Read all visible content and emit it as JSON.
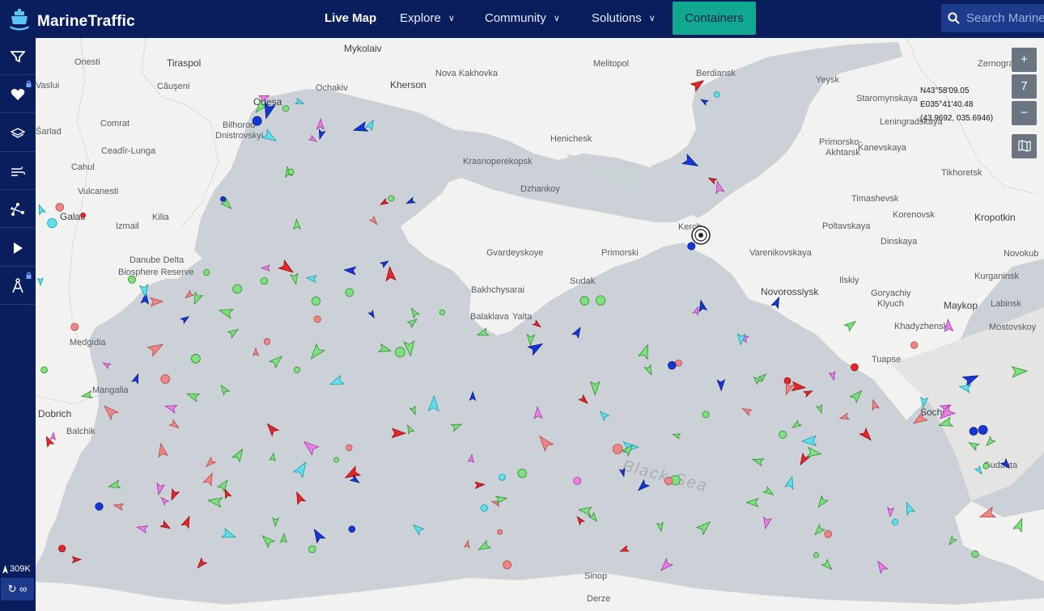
{
  "header": {
    "brand": "MarineTraffic",
    "nav": [
      "Live Map",
      "Explore",
      "Community",
      "Solutions"
    ],
    "containers_label": "Containers",
    "search_placeholder": "Search MarineTraffic"
  },
  "sidebar": {
    "items": [
      "filter-icon",
      "heart-icon",
      "layers-icon",
      "wind-icon",
      "route-icon",
      "play-icon",
      "measure-icon"
    ],
    "vessel_count": "309K",
    "infinity_label": "∞"
  },
  "map_controls": {
    "zoom_in": "+",
    "zoom_level": "7",
    "zoom_out": "−"
  },
  "cursor_coordinates": {
    "lat": "N43°58'09.05",
    "lon": "E035°41'40.48",
    "decimal": "(43.9692, 035.6946)"
  },
  "map_labels": {
    "sea": "Black Sea",
    "places": [
      "Onesti",
      "Tiraspol",
      "Mykolaiv",
      "Melitopol",
      "Berdiansk",
      "Zernograd",
      "Vaslui",
      "Căuşeni",
      "Odesa",
      "Ochakiv",
      "Kherson",
      "Nova Kakhovka",
      "Yeysk",
      "Staromynskaya",
      "Comrat",
      "Bilhorod-Dnistrovskyi",
      "Henichesk",
      "Leningradskaya",
      "Primorsko-Akhtarsk",
      "Kanevskaya",
      "Ceadîr-Lunga",
      "Cahul",
      "Vulcanesti",
      "Krasnoperekopsk",
      "Dzhankoy",
      "Tikhoretsk",
      "Timashevsk",
      "Galati",
      "Izmail",
      "Kilia",
      "Korenovsk",
      "Kropotkin",
      "Poltavskaya",
      "Dinskaya",
      "Gvardeyskoye",
      "Primorski",
      "Kerch",
      "Varenikovskaya",
      "Danube Delta Biosphere Reserve",
      "Sudak",
      "Novorossiysk",
      "Ilskiy",
      "Goryachiy Klyuch",
      "Kurganinsk",
      "Bakhchysarai",
      "Maykop",
      "Labinsk",
      "Yalta",
      "Balaklava",
      "Medgidia",
      "Khadyzhensk",
      "Mostovskoy",
      "Tuapse",
      "Mangalia",
      "Dobrich",
      "Balchik",
      "Sochi",
      "Gudauta",
      "Novokub",
      "Derze",
      "Sinop"
    ]
  }
}
